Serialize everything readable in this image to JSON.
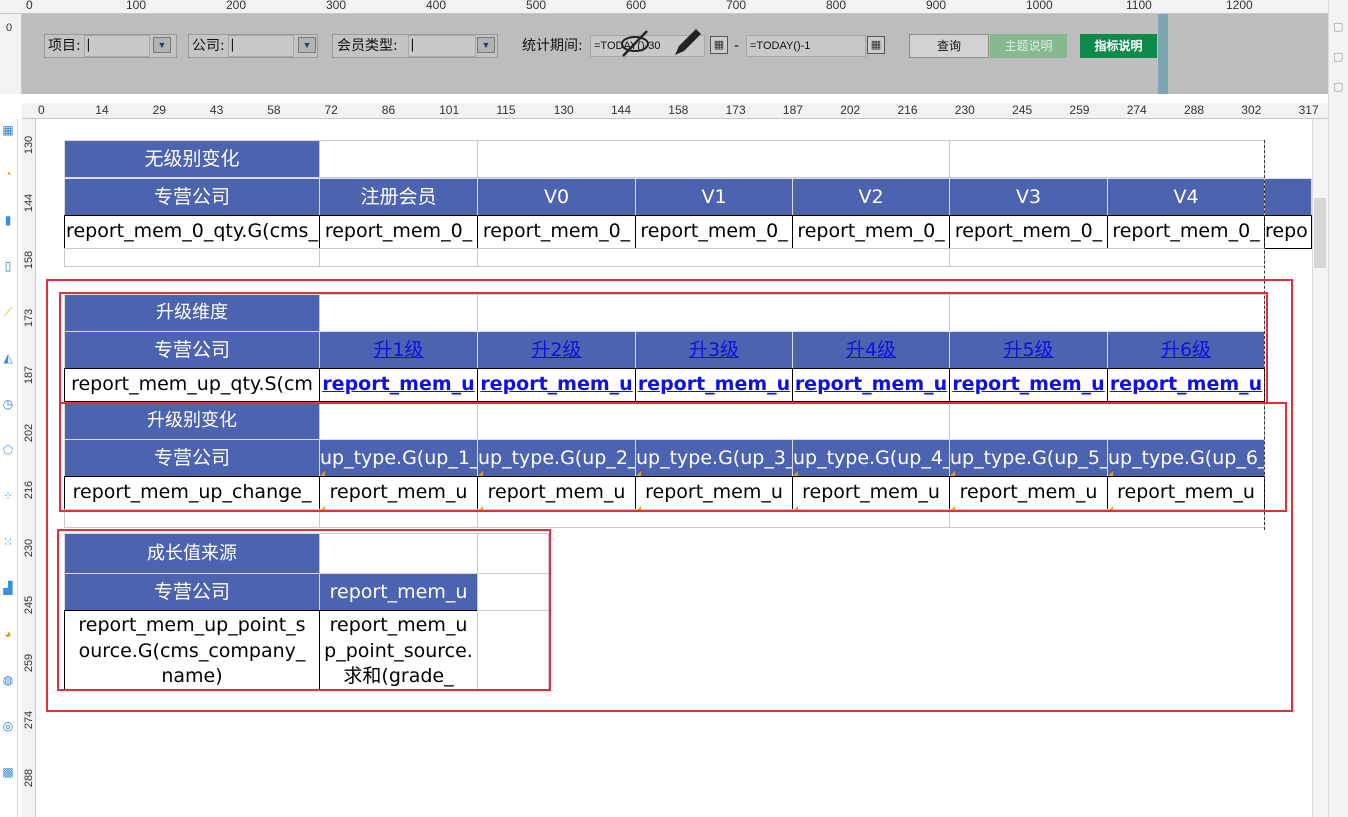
{
  "top_ruler": {
    "ticks": [
      "0",
      "100",
      "200",
      "300",
      "400",
      "500",
      "600",
      "700",
      "800",
      "900",
      "1000",
      "1100",
      "1200"
    ],
    "side_tick": "0"
  },
  "params": {
    "project_label": "项目:",
    "company_label": "公司:",
    "member_type_label": "会员类型:",
    "period_label": "统计期间:",
    "period_start": "=TODAY()-30",
    "period_sep": "-",
    "period_end": "=TODAY()-1",
    "query_button": "查询",
    "theme_button": "主题说明",
    "metric_button": "指标说明"
  },
  "canvas_ruler": {
    "h_ticks": [
      "0",
      "14",
      "29",
      "43",
      "58",
      "72",
      "86",
      "101",
      "115",
      "130",
      "144",
      "158",
      "173",
      "187",
      "202",
      "216",
      "230",
      "245",
      "259",
      "274",
      "288",
      "302",
      "317"
    ],
    "v_ticks": [
      "130",
      "144",
      "158",
      "173",
      "187",
      "202",
      "216",
      "230",
      "245",
      "259",
      "274",
      "288"
    ]
  },
  "report": {
    "section1": {
      "title": "无级别变化",
      "company_header": "专营公司",
      "headers": [
        "注册会员",
        "V0",
        "V1",
        "V2",
        "V3",
        "V4"
      ],
      "row_first": "report_mem_0_qty.G(cms_",
      "row_cells": [
        "report_mem_0_",
        "report_mem_0_",
        "report_mem_0_",
        "report_mem_0_",
        "report_mem_0_",
        "report_mem_0_",
        "repo"
      ]
    },
    "section2": {
      "title": "升级维度",
      "company_header": "专营公司",
      "headers": [
        "升1级",
        "升2级",
        "升3级",
        "升4级",
        "升5级",
        "升6级"
      ],
      "row_first": "report_mem_up_qty.S(cm",
      "row_cells": [
        "report_mem_u",
        "report_mem_u",
        "report_mem_u",
        "report_mem_u",
        "report_mem_u",
        "report_mem_u"
      ]
    },
    "section3": {
      "title": "升级别变化",
      "company_header": "专营公司",
      "headers": [
        "up_type.G(up_1_",
        "up_type.G(up_2_",
        "up_type.G(up_3_",
        "up_type.G(up_4_",
        "up_type.G(up_5_",
        "up_type.G(up_6_"
      ],
      "row_first": "report_mem_up_change_",
      "row_cells": [
        "report_mem_u",
        "report_mem_u",
        "report_mem_u",
        "report_mem_u",
        "report_mem_u",
        "report_mem_u"
      ]
    },
    "section4": {
      "title": "成长值来源",
      "company_header": "专营公司",
      "header_value": "report_mem_u",
      "row_first": "report_mem_up_point_source.G(cms_company_name)",
      "row_value": "report_mem_up_point_source.求和(grade_"
    }
  },
  "colors": {
    "header_blue": "#4c63b0",
    "highlight_red": "#e5303a",
    "link_blue": "#1010e0",
    "metric_green": "#0f8a4a"
  }
}
